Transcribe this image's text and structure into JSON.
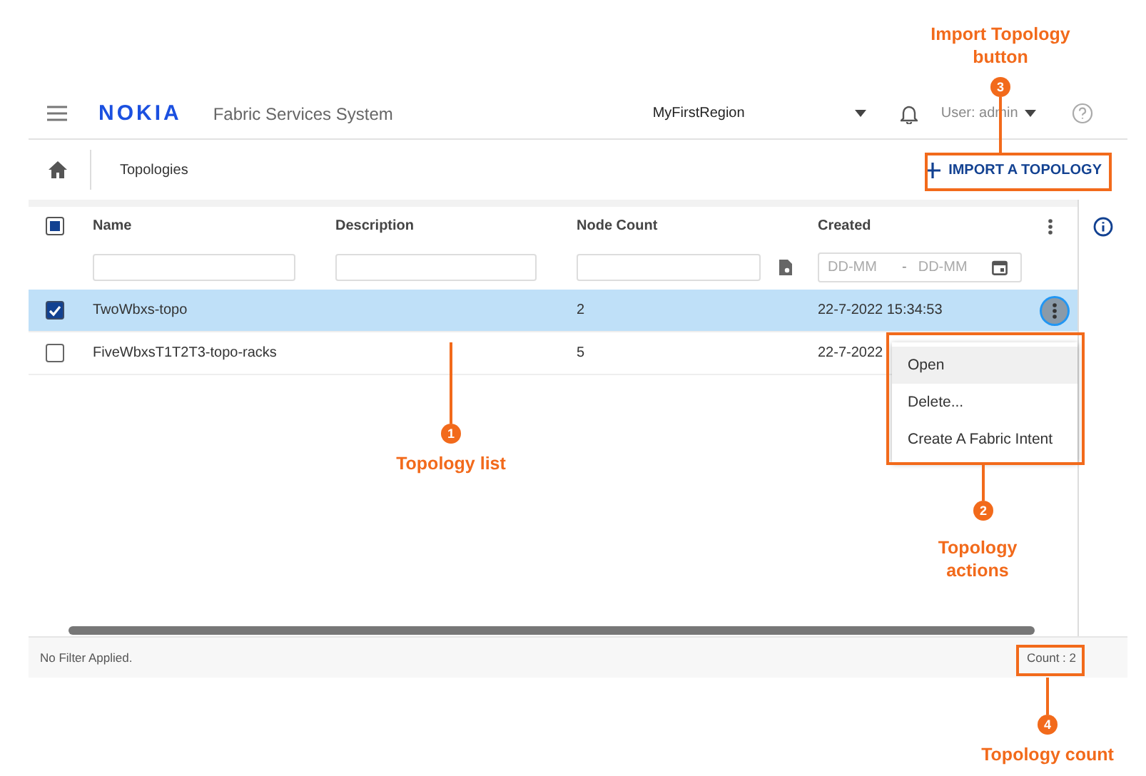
{
  "header": {
    "logo": "NOKIA",
    "app_title": "Fabric Services System",
    "region": "MyFirstRegion",
    "user": "User: admin"
  },
  "breadcrumb": {
    "page": "Topologies"
  },
  "import_button": {
    "label": "IMPORT A TOPOLOGY"
  },
  "table": {
    "header_checkbox": {
      "indeterminate": true
    },
    "columns": [
      "Name",
      "Description",
      "Node Count",
      "Created"
    ],
    "date_filter": {
      "from_placeholder": "DD-MM",
      "separator": "-",
      "to_placeholder": "DD-MM"
    },
    "rows": [
      {
        "name": "TwoWbxs-topo",
        "node_count": "2",
        "created": "22-7-2022 15:34:53",
        "selected": true
      },
      {
        "name": "FiveWbxsT1T2T3-topo-racks",
        "node_count": "5",
        "created": "22-7-2022",
        "selected": false
      }
    ]
  },
  "row_menu": {
    "items": [
      {
        "label": "Open",
        "selected": true
      },
      {
        "label": "Delete...",
        "selected": false
      },
      {
        "label": "Create A Fabric Intent",
        "selected": false
      }
    ]
  },
  "footer": {
    "filter_status": "No Filter Applied.",
    "count": "Count : 2"
  },
  "callouts": [
    {
      "number": "3",
      "label": "Import Topology button"
    },
    {
      "number": "1",
      "label": "Topology list"
    },
    {
      "number": "2",
      "label": "Topology actions"
    },
    {
      "number": "4",
      "label": "Topology count"
    }
  ]
}
